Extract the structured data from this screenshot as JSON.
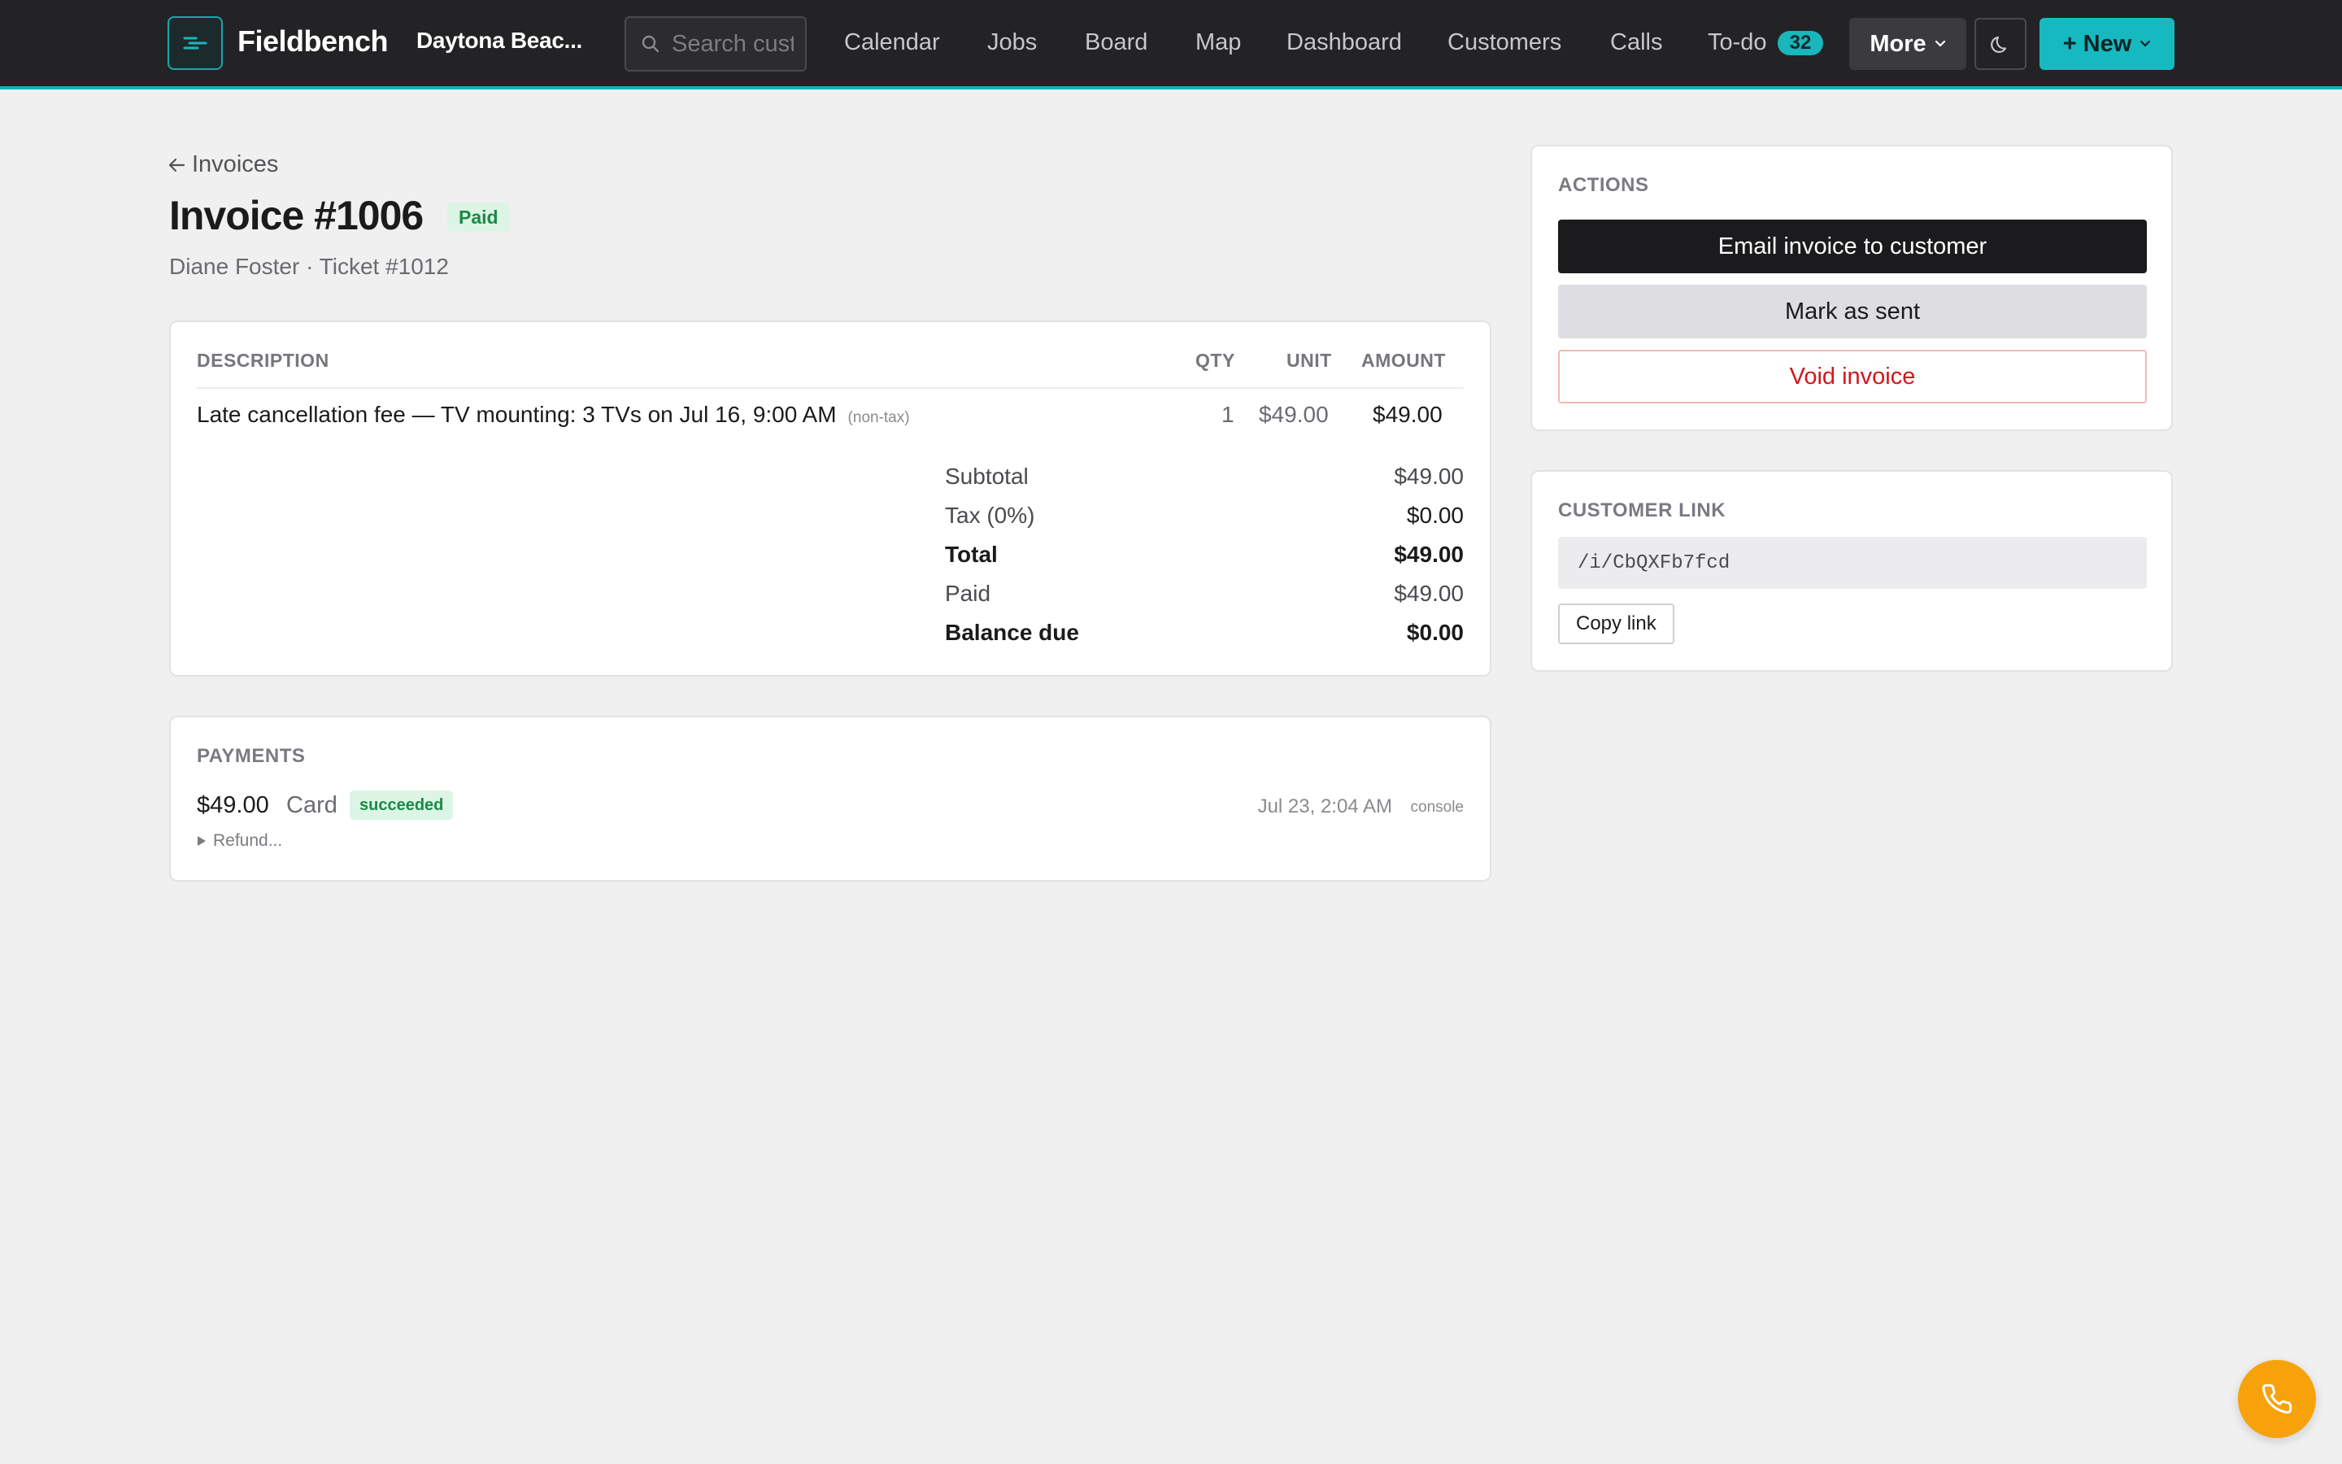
{
  "nav": {
    "brand": "Fieldbench",
    "location": "Daytona Beac...",
    "search_placeholder": "Search customers",
    "links": [
      "Calendar",
      "Jobs",
      "Board",
      "Map",
      "Dashboard",
      "Customers",
      "Calls",
      "To-do"
    ],
    "todo_count": "32",
    "more_label": "More",
    "new_label": "+ New",
    "accent_color": "#16b9bf"
  },
  "header": {
    "back_label": "Invoices",
    "title": "Invoice #1006",
    "status": "Paid",
    "subtitle": "Diane Foster · Ticket #1012"
  },
  "items": {
    "columns": {
      "description": "DESCRIPTION",
      "qty": "QTY",
      "unit": "UNIT",
      "amount": "AMOUNT"
    },
    "lines": [
      {
        "description": "Late cancellation fee — TV mounting: 3 TVs on Jul 16, 9:00 AM",
        "note": "(non-tax)",
        "qty": "1",
        "unit": "$49.00",
        "amount": "$49.00"
      }
    ],
    "totals": [
      {
        "label": "Subtotal",
        "value": "$49.00",
        "bold": false
      },
      {
        "label": "Tax (0%)",
        "value": "$0.00",
        "bold": false
      },
      {
        "label": "Total",
        "value": "$49.00",
        "bold": true
      },
      {
        "label": "Paid",
        "value": "$49.00",
        "bold": false
      },
      {
        "label": "Balance due",
        "value": "$0.00",
        "bold": true
      }
    ]
  },
  "payments": {
    "label": "PAYMENTS",
    "entries": [
      {
        "amount": "$49.00",
        "method": "Card",
        "status": "succeeded",
        "date": "Jul 23, 2:04 AM",
        "source": "console",
        "refund_label": "Refund..."
      }
    ]
  },
  "actions": {
    "label": "ACTIONS",
    "email": "Email invoice to customer",
    "mark_sent": "Mark as sent",
    "void": "Void invoice"
  },
  "customer_link": {
    "label": "CUSTOMER LINK",
    "url": "/i/CbQXFb7fcd",
    "copy": "Copy link"
  },
  "icons": {
    "logo": "fieldbench-logo-icon",
    "search": "search-icon",
    "back": "arrow-left-icon",
    "theme": "moon-icon",
    "phone": "phone-icon"
  }
}
